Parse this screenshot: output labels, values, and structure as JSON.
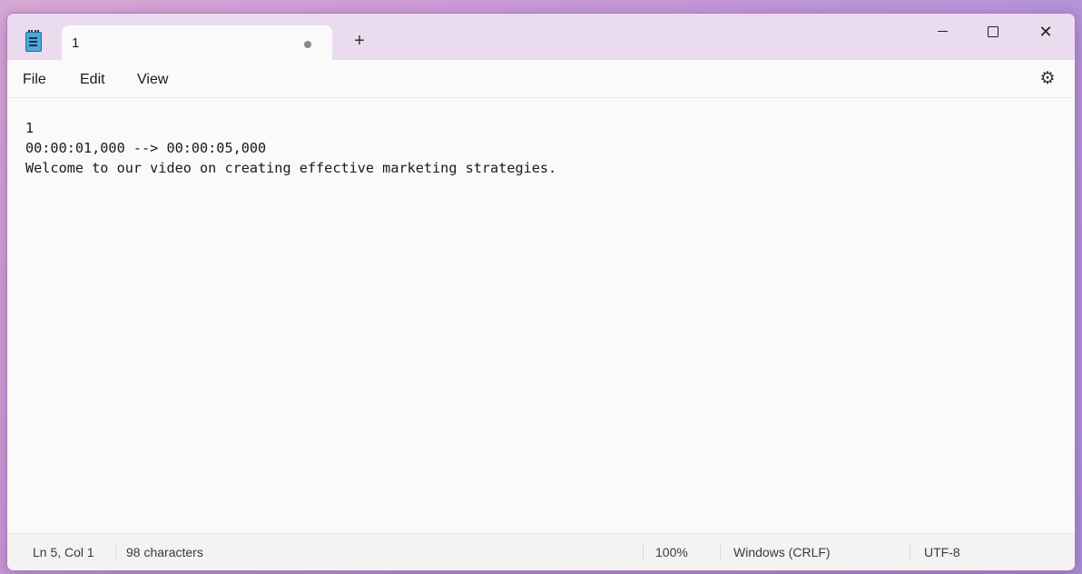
{
  "window": {
    "tab": {
      "title": "1",
      "unsaved_indicator": "●"
    },
    "new_tab_label": "+",
    "controls": {
      "minimize": "",
      "maximize": "",
      "close": "✕"
    }
  },
  "menu": {
    "file": "File",
    "edit": "Edit",
    "view": "View",
    "settings_icon": "⚙"
  },
  "editor": {
    "lines": [
      "1",
      "00:00:01,000 --> 00:00:05,000",
      "Welcome to our video on creating effective marketing strategies."
    ]
  },
  "status": {
    "position": "Ln 5, Col 1",
    "characters": "98 characters",
    "zoom": "100%",
    "line_ending": "Windows (CRLF)",
    "encoding": "UTF-8"
  },
  "colors": {
    "titlebar": "#ebdbee",
    "editor_bg": "#fafafa",
    "app_icon": "#4fa6d9"
  }
}
